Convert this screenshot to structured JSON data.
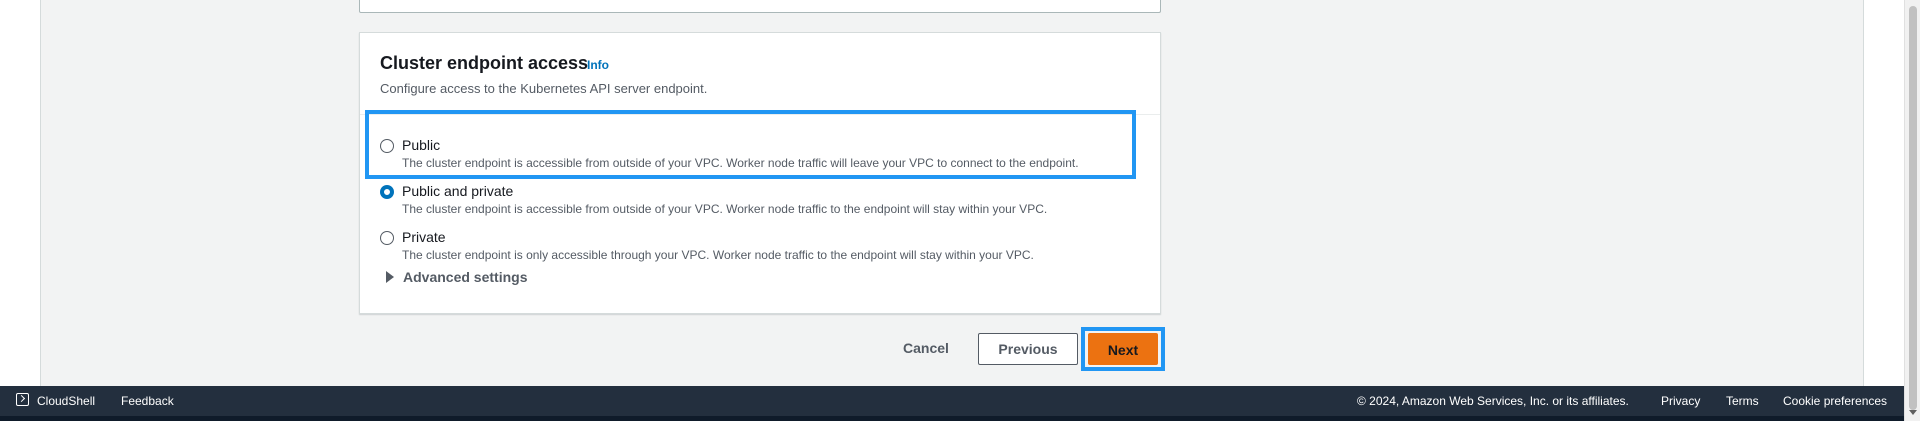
{
  "section": {
    "title": "Cluster endpoint access",
    "info_link": "Info",
    "description": "Configure access to the Kubernetes API server endpoint."
  },
  "options": [
    {
      "label": "Public",
      "description": "The cluster endpoint is accessible from outside of your VPC. Worker node traffic will leave your VPC to connect to the endpoint.",
      "selected": false
    },
    {
      "label": "Public and private",
      "description": "The cluster endpoint is accessible from outside of your VPC. Worker node traffic to the endpoint will stay within your VPC.",
      "selected": true
    },
    {
      "label": "Private",
      "description": "The cluster endpoint is only accessible through your VPC. Worker node traffic to the endpoint will stay within your VPC.",
      "selected": false
    }
  ],
  "advanced_settings": {
    "label": "Advanced settings",
    "icon": "caret-right-icon"
  },
  "actions": {
    "cancel": "Cancel",
    "previous": "Previous",
    "next": "Next"
  },
  "footer": {
    "cloudshell": "CloudShell",
    "cloudshell_icon": "terminal-icon",
    "feedback": "Feedback",
    "copyright": "© 2024, Amazon Web Services, Inc. or its affiliates.",
    "privacy": "Privacy",
    "terms": "Terms",
    "cookie_preferences": "Cookie preferences"
  },
  "colors": {
    "primary_button": "#ec7211",
    "selected_radio": "#0073bb",
    "link": "#0073bb",
    "highlight": "#2196f3",
    "footer_bg": "#232f3e"
  }
}
